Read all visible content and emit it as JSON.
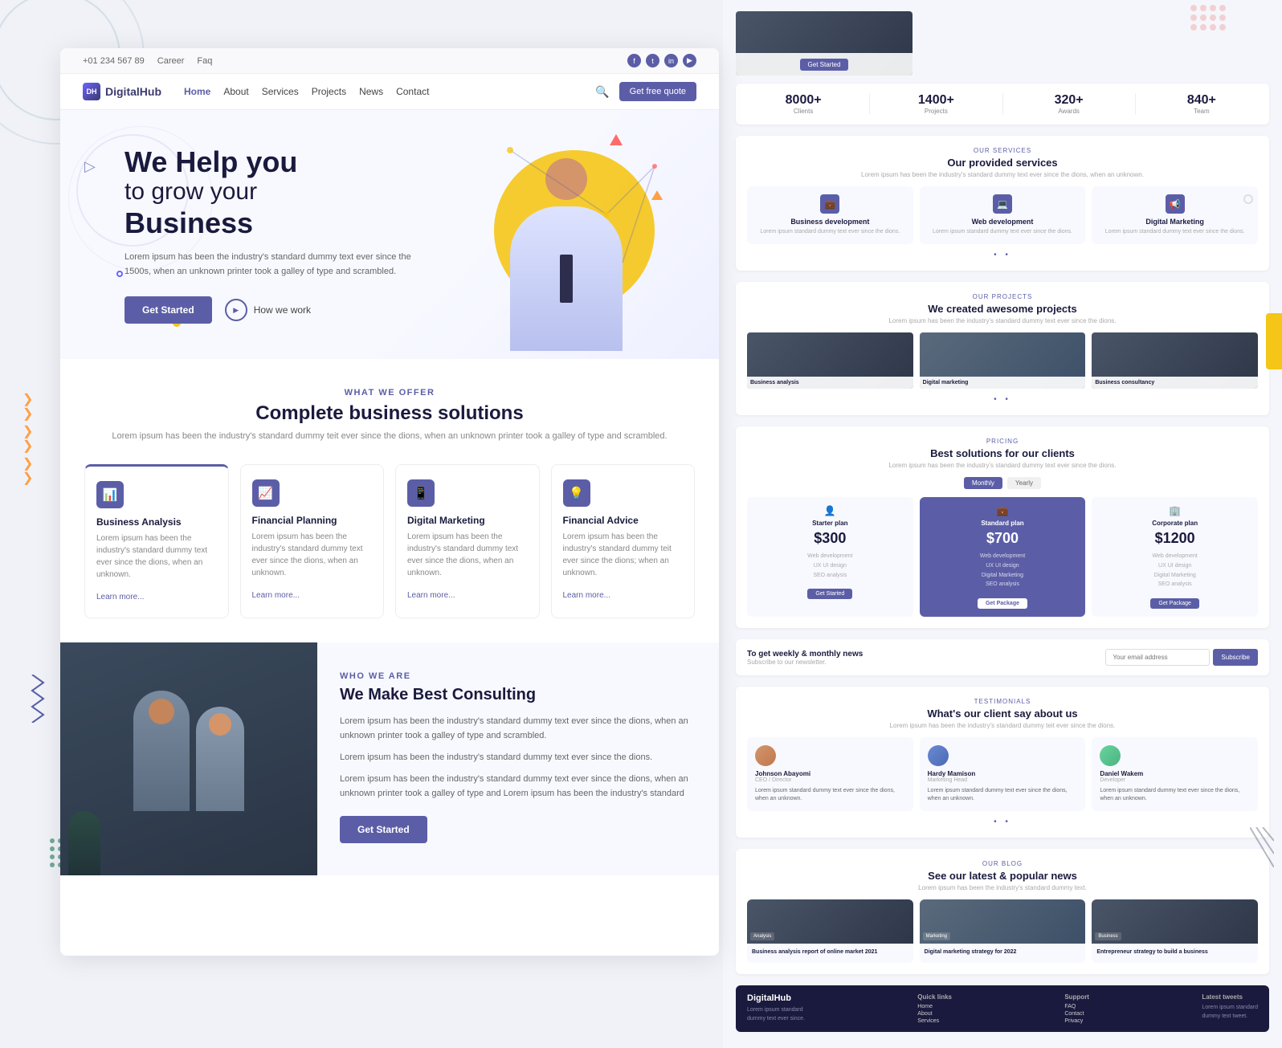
{
  "brand": {
    "name": "DigitalHub",
    "logo_text": "DH"
  },
  "topbar": {
    "phone": "+01 234 567 89",
    "career": "Career",
    "faq": "Faq",
    "socials": [
      "f",
      "t",
      "in",
      "yt"
    ]
  },
  "nav": {
    "links": [
      "Home",
      "About",
      "Services",
      "Projects",
      "News",
      "Contact"
    ],
    "active": "Home",
    "cta": "Get free quote",
    "search_placeholder": "Search..."
  },
  "hero": {
    "title_line1": "We Help you",
    "title_line2": "to grow your",
    "title_line3": "Business",
    "description": "Lorem ipsum has been the industry's standard dummy text ever since the 1500s, when an unknown printer took a galley of type and scrambled.",
    "btn_primary": "Get Started",
    "btn_secondary": "How we work"
  },
  "offer": {
    "label": "WHAT WE OFFER",
    "title": "Complete business solutions",
    "description": "Lorem ipsum has been the industry's standard dummy teit ever since the dions, when an unknown printer took a galley of type and scrambled.",
    "services": [
      {
        "icon": "📊",
        "name": "Business Analysis",
        "text": "Lorem ipsum has been the industry's standard dummy text ever since the dions, when an unknown.",
        "link": "Learn more..."
      },
      {
        "icon": "📈",
        "name": "Financial Planning",
        "text": "Lorem ipsum has been the industry's standard dummy text ever since the dions, when an unknown.",
        "link": "Learn more..."
      },
      {
        "icon": "📱",
        "name": "Digital Marketing",
        "text": "Lorem ipsum has been the industry's standard dummy text ever since the dions, when an unknown.",
        "link": "Learn more..."
      },
      {
        "icon": "💡",
        "name": "Financial Advice",
        "text": "Lorem ipsum has been the industry's standard dummy teit ever since the dions; when an unknown.",
        "link": "Learn more..."
      }
    ]
  },
  "who": {
    "label": "WHO WE ARE",
    "title": "We Make Best Consulting",
    "text1": "Lorem ipsum has been the industry's standard dummy text ever since the dions, when an unknown printer took a galley of type and scrambled.",
    "text2": "Lorem ipsum has been the industry's standard dummy text ever since the dions.",
    "text3": "Lorem ipsum has been the industry's standard dummy text ever since the dions, when an unknown printer took a galley of type and Lorem ipsum has been the industry's standard",
    "btn": "Get Started"
  },
  "stats": [
    {
      "num": "8000+",
      "label": "Clients"
    },
    {
      "num": "1400+",
      "label": "Projects"
    },
    {
      "num": "320+",
      "label": "Awards"
    },
    {
      "num": "840+",
      "label": "Team"
    }
  ],
  "right_services": {
    "label": "OUR SERVICES",
    "title": "Our provided services",
    "desc": "Lorem ipsum has been the industry's standard dummy text ever since the dions, when an unknown.",
    "items": [
      {
        "icon": "💼",
        "name": "Business development",
        "text": "Lorem ipsum standard dummy text ever since the dions."
      },
      {
        "icon": "💻",
        "name": "Web development",
        "text": "Lorem ipsum standard dummy text ever since the dions."
      },
      {
        "icon": "📢",
        "name": "Digital Marketing",
        "text": "Lorem ipsum standard dummy text ever since the dions."
      }
    ]
  },
  "right_projects": {
    "label": "OUR PROJECTS",
    "title": "We created awesome projects",
    "desc": "Lorem ipsum has been the industry's standard dummy text ever since the dions.",
    "items": [
      {
        "name": "Business analysis"
      },
      {
        "name": "Digital marketing"
      },
      {
        "name": "Business consultancy"
      }
    ]
  },
  "right_pricing": {
    "label": "PRICING",
    "title": "Best solutions for our clients",
    "desc": "Lorem ipsum has been the industry's standard dummy text ever since the dions.",
    "plans": [
      {
        "name": "Starter plan",
        "price": "$300",
        "features": "Web development\nUX UI design\nSEO analysis",
        "btn": "Get Started",
        "featured": false
      },
      {
        "name": "Standard plan",
        "price": "$700",
        "features": "Web development\nUX UI design\nDigital Marketing\nSEO analysis",
        "btn": "Get Package",
        "featured": true
      },
      {
        "name": "Corporate plan",
        "price": "$1200",
        "features": "Web development\nUX UI design\nDigital Marketing\nSEO analysis",
        "btn": "Get Package",
        "featured": false
      }
    ]
  },
  "newsletter": {
    "title": "To get weekly & monthly news",
    "subtitle": "Subscribe to our newsletter.",
    "placeholder": "Your email address",
    "btn": "Subscribe"
  },
  "testimonials": {
    "label": "TESTIMONIALS",
    "title": "What's our client say about us",
    "desc": "Lorem ipsum has been the industry's standard dummy teit ever since the dions.",
    "items": [
      {
        "name": "Johnson Abayomi",
        "role": "CEO / Director",
        "text": "Lorem ipsum standard dummy text ever since the dions, when an unknown."
      },
      {
        "name": "Hardy Mamison",
        "role": "Marketing Head",
        "text": "Lorem ipsum standard dummy text ever since the dions, when an unknown."
      },
      {
        "name": "Daniel Wakem",
        "role": "Developer",
        "text": "Lorem ipsum standard dummy text ever since the dions, when an unknown."
      }
    ]
  },
  "news": {
    "label": "OUR BLOG",
    "title": "See our latest & popular news",
    "desc": "Lorem ipsum has been the industry's standard dummy text.",
    "items": [
      {
        "title": "Business analysis report of online market 2021"
      },
      {
        "title": "Digital marketing strategy for 2022"
      },
      {
        "title": "Entrepreneur strategy to build a business"
      }
    ]
  },
  "footer": {
    "brand": "DigitalHub",
    "quick_links": "Quick links",
    "support": "Support",
    "latest_tweets": "Latest tweets"
  },
  "left_decorations": {
    "chevrons": "❯❯❯",
    "zigzag": "~"
  }
}
